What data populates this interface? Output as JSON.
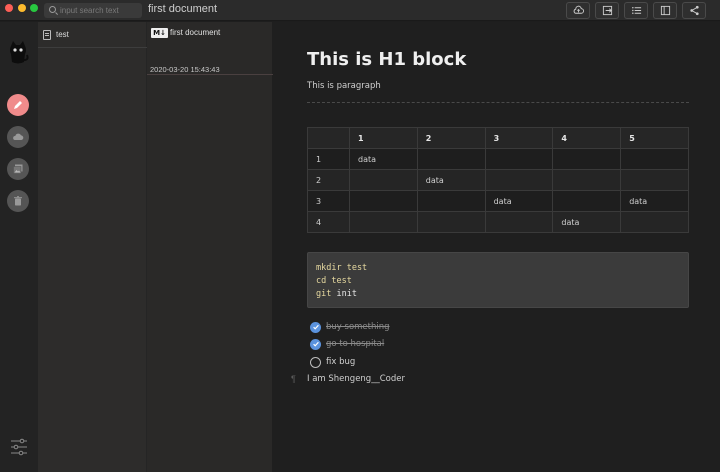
{
  "titlebar": {
    "search_placeholder": "input search text",
    "document_title": "first document"
  },
  "toolbar": {
    "icons": [
      "upload-icon",
      "export-icon",
      "outline-list-icon",
      "layout-icon",
      "share-icon"
    ]
  },
  "rail": {
    "icons": [
      "cat-logo-icon",
      "edit-icon",
      "cloud-icon",
      "images-icon",
      "trash-icon",
      "settings-sliders-icon"
    ],
    "active_color": "#f08b8b"
  },
  "folders": {
    "items": [
      {
        "label": "test"
      }
    ]
  },
  "documents": {
    "items": [
      {
        "badge": "M↓",
        "name": "first document",
        "date": "2020-03-20 15:43:43"
      }
    ]
  },
  "editor": {
    "h1": "This is H1 block",
    "paragraph": "This is paragraph",
    "table": {
      "headers": [
        "",
        "1",
        "2",
        "3",
        "4",
        "5"
      ],
      "rows": [
        [
          "1",
          "data",
          "",
          "",
          "",
          ""
        ],
        [
          "2",
          "",
          "data",
          "",
          "",
          ""
        ],
        [
          "3",
          "",
          "",
          "data",
          "",
          "data"
        ],
        [
          "4",
          "",
          "",
          "",
          "data",
          ""
        ]
      ]
    },
    "code": {
      "line1_cmd": "mkdir test",
      "line2_cmd": "cd test",
      "line3_kw": "git",
      "line3_arg": "init"
    },
    "tasks": [
      {
        "text": "buy something",
        "done": true
      },
      {
        "text": "go to hospital",
        "done": true
      },
      {
        "text": "fix bug",
        "done": false
      }
    ],
    "last_paragraph": "I am Shengeng__Coder",
    "pilcrow": "¶"
  },
  "colors": {
    "check_blue": "#5b93de",
    "background": "#1f1f1f"
  }
}
